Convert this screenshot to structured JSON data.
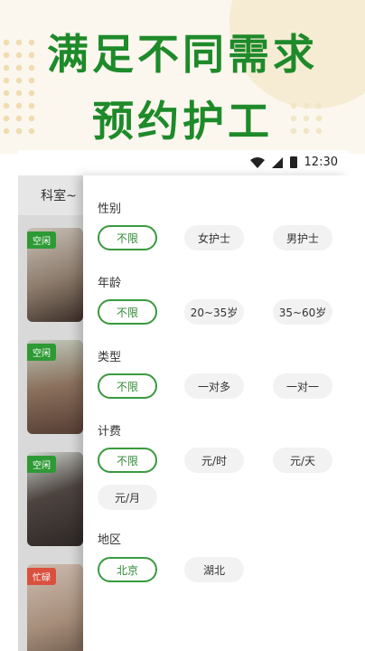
{
  "promo": {
    "line1": "满足不同需求",
    "line2": "预约护工"
  },
  "statusbar": {
    "time": "12:30",
    "icons": [
      "wifi-icon",
      "signal-icon",
      "battery-icon"
    ]
  },
  "list": {
    "dept_label": "科室~",
    "cards": [
      {
        "status": "空闲"
      },
      {
        "status": "空闲"
      },
      {
        "status": "空闲"
      },
      {
        "status": "忙碌"
      }
    ]
  },
  "filters": {
    "gender": {
      "title": "性别",
      "options": [
        "不限",
        "女护士",
        "男护士"
      ],
      "selected": "不限"
    },
    "age": {
      "title": "年龄",
      "options": [
        "不限",
        "20~35岁",
        "35~60岁"
      ],
      "selected": "不限"
    },
    "type": {
      "title": "类型",
      "options": [
        "不限",
        "一对多",
        "一对一"
      ],
      "selected": "不限"
    },
    "billing": {
      "title": "计费",
      "options": [
        "不限",
        "元/时",
        "元/天",
        "元/月"
      ],
      "selected": "不限"
    },
    "region": {
      "title": "地区",
      "options": [
        "北京",
        "湖北"
      ],
      "selected": "北京"
    }
  },
  "colors": {
    "brand_green": "#1e8a2a",
    "chip_active_border": "#3a9a3e",
    "busy_tag": "#d9503f"
  }
}
